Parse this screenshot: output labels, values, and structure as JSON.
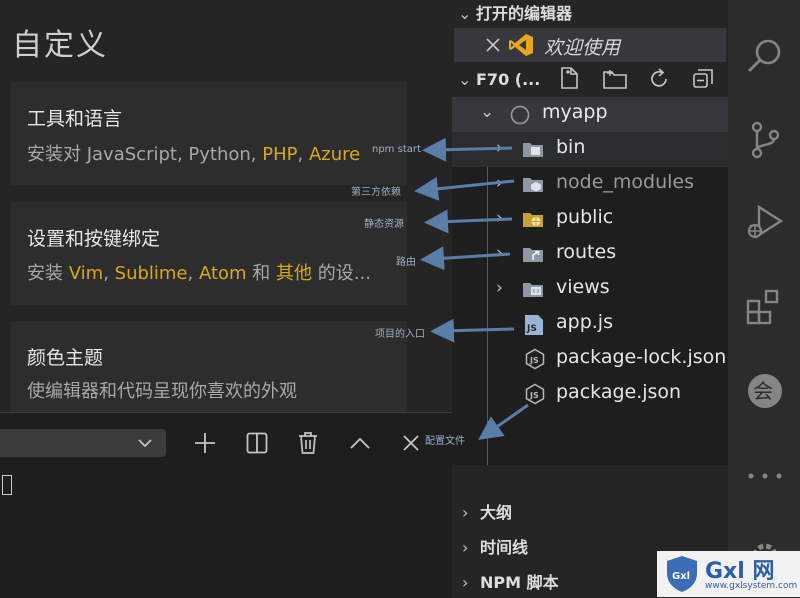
{
  "welcome": {
    "title": "自定义",
    "cards": [
      {
        "title": "工具和语言",
        "desc_prefix": "安装对 JavaScript, Python, ",
        "desc_hl1": "PHP",
        "desc_mid": ", ",
        "desc_hl2": "Azure",
        "desc_suffix": ""
      },
      {
        "title": "设置和按键绑定",
        "desc_prefix": "安装 ",
        "desc_hl1": "Vim",
        "desc_mid1": ", ",
        "desc_hl2": "Sublime",
        "desc_mid2": ", ",
        "desc_hl3": "Atom",
        "desc_mid3": " 和 ",
        "desc_hl4": "其他",
        "desc_suffix": " 的设..."
      },
      {
        "title": "颜色主题",
        "desc": "使编辑器和代码呈现你喜欢的外观"
      }
    ]
  },
  "terminal": {
    "toolbar_icons": [
      "add-icon",
      "split-icon",
      "trash-icon",
      "chevron-up-icon",
      "close-icon"
    ]
  },
  "explorer": {
    "open_editors_label": "打开的编辑器",
    "open_editor_file": "欢迎使用",
    "workspace_label": "F70 (...",
    "root_folder": "myapp",
    "items": [
      {
        "name": "bin",
        "kind": "folder"
      },
      {
        "name": "node_modules",
        "kind": "folder"
      },
      {
        "name": "public",
        "kind": "folder"
      },
      {
        "name": "routes",
        "kind": "folder"
      },
      {
        "name": "views",
        "kind": "folder"
      },
      {
        "name": "app.js",
        "kind": "js-file"
      },
      {
        "name": "package-lock.json",
        "kind": "json-file"
      },
      {
        "name": "package.json",
        "kind": "json-file"
      }
    ],
    "outline_label": "大纲",
    "timeline_label": "时间线",
    "npm_label": "NPM 脚本"
  },
  "annotations": {
    "bin": "npm start",
    "node_modules": "第三方依赖",
    "public": "静态资源",
    "routes": "路由",
    "app": "项目的入口",
    "package": "配置文件"
  },
  "watermark": {
    "text": "Gxl 网",
    "url": "www.gxlsystem.com"
  },
  "colors": {
    "accent": "#d9a81b",
    "annotation_arrow": "#5a7ea8",
    "selected_row": "#37373d"
  }
}
